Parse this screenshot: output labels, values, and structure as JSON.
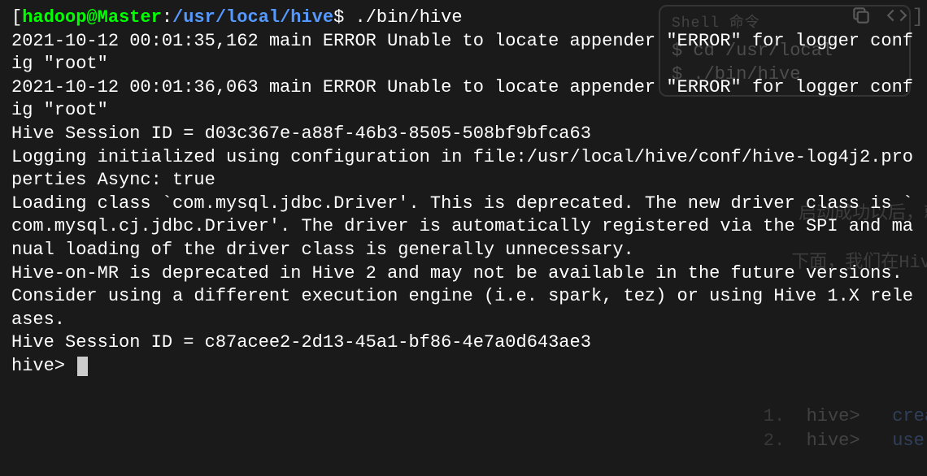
{
  "prompt": {
    "open_bracket": "[",
    "user_host": "hadoop@Master",
    "separator": ":",
    "path": "/usr/local/hive",
    "dollar": "$ ",
    "command": "./bin/hive"
  },
  "output_lines": [
    "2021-10-12 00:01:35,162 main ERROR Unable to locate appender \"ERROR\" for logger config \"root\"",
    "2021-10-12 00:01:36,063 main ERROR Unable to locate appender \"ERROR\" for logger config \"root\"",
    "Hive Session ID = d03c367e-a88f-46b3-8505-508bf9bfca63",
    "",
    "Logging initialized using configuration in file:/usr/local/hive/conf/hive-log4j2.properties Async: true",
    "Loading class `com.mysql.jdbc.Driver'. This is deprecated. The new driver class is `com.mysql.cj.jdbc.Driver'. The driver is automatically registered via the SPI and manual loading of the driver class is generally unnecessary.",
    "Hive-on-MR is deprecated in Hive 2 and may not be available in the future versions. Consider using a different execution engine (i.e. spark, tez) or using Hive 1.X releases.",
    "Hive Session ID = c87acee2-2d13-45a1-bf86-4e7a0d643ae3"
  ],
  "hive_prompt": "hive> ",
  "background": {
    "shell_label": "Shell 命令",
    "shell_line1": "$ cd /usr/local",
    "shell_line2": "$ ./bin/hive",
    "text1": "启动成功以后，就进",
    "text2": "下面，我们在Hive中",
    "hive1_num": "1.  ",
    "hive1_prompt": "hive>   ",
    "hive1_kw": "crea",
    "hive2_num": "2.  ",
    "hive2_prompt": "hive>   ",
    "hive2_kw": "use ",
    "close_bracket": "]"
  }
}
